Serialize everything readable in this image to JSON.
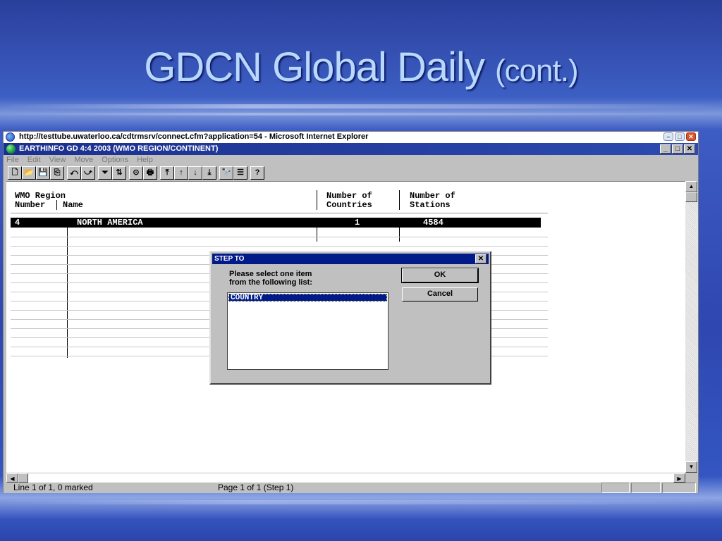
{
  "slide": {
    "title_main": "GDCN Global Daily",
    "title_small": "(cont.)"
  },
  "browser": {
    "title": "http://testtube.uwaterloo.ca/cdtrmsrv/connect.cfm?application=54 - Microsoft Internet Explorer",
    "buttons": {
      "minimize": "–",
      "maximize": "□",
      "close": "✕"
    }
  },
  "app": {
    "title": "EARTHINFO GD 4:4 2003 (WMO REGION/CONTINENT)",
    "buttons": {
      "minimize": "_",
      "maximize": "□",
      "close": "✕"
    },
    "menu": [
      "File",
      "Edit",
      "View",
      "Move",
      "Options",
      "Help"
    ],
    "toolbar": {
      "file_group": [
        "🗋",
        "📂",
        "💾",
        "⎘"
      ],
      "nav_group": [
        "⤺",
        "⤻"
      ],
      "filter_group": [
        "⏷",
        "⇅"
      ],
      "print_group": [
        "⊙",
        "🖶"
      ],
      "move_group": [
        "⤒",
        "↑",
        "↓",
        "⤓"
      ],
      "find_group": [
        "🔭",
        "☰"
      ],
      "help_group": [
        "?"
      ]
    }
  },
  "table": {
    "header": {
      "wmo_region": "WMO Region",
      "number": "Number",
      "name": "Name",
      "number_of_1": "Number of",
      "countries": "Countries",
      "number_of_2": "Number of",
      "stations": "Stations"
    },
    "rows": [
      {
        "number": "4",
        "name": "NORTH AMERICA",
        "countries": "1",
        "stations": "4584"
      }
    ]
  },
  "statusbar": {
    "line_info": "Line 1 of 1, 0 marked",
    "page_info": "Page 1 of 1 (Step 1)"
  },
  "scroll": {
    "up": "▲",
    "down": "▼",
    "left": "◀",
    "right": "▶"
  },
  "dialog": {
    "title": "STEP TO",
    "close": "✕",
    "prompt_line1": "Please select one item",
    "prompt_line2": "from the following list:",
    "items": [
      "COUNTRY"
    ],
    "ok_label": "OK",
    "cancel_label": "Cancel"
  }
}
